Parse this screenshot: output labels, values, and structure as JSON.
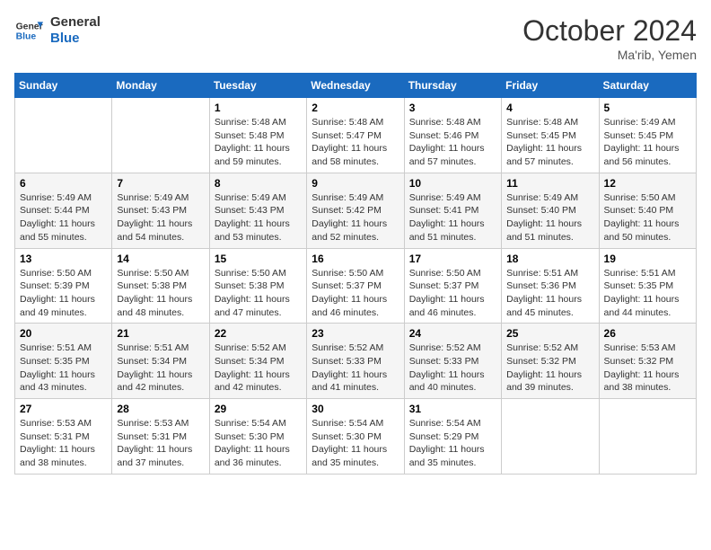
{
  "header": {
    "logo_line1": "General",
    "logo_line2": "Blue",
    "month": "October 2024",
    "location": "Ma'rib, Yemen"
  },
  "weekdays": [
    "Sunday",
    "Monday",
    "Tuesday",
    "Wednesday",
    "Thursday",
    "Friday",
    "Saturday"
  ],
  "weeks": [
    [
      {
        "day": "",
        "info": ""
      },
      {
        "day": "",
        "info": ""
      },
      {
        "day": "1",
        "info": "Sunrise: 5:48 AM\nSunset: 5:48 PM\nDaylight: 11 hours and 59 minutes."
      },
      {
        "day": "2",
        "info": "Sunrise: 5:48 AM\nSunset: 5:47 PM\nDaylight: 11 hours and 58 minutes."
      },
      {
        "day": "3",
        "info": "Sunrise: 5:48 AM\nSunset: 5:46 PM\nDaylight: 11 hours and 57 minutes."
      },
      {
        "day": "4",
        "info": "Sunrise: 5:48 AM\nSunset: 5:45 PM\nDaylight: 11 hours and 57 minutes."
      },
      {
        "day": "5",
        "info": "Sunrise: 5:49 AM\nSunset: 5:45 PM\nDaylight: 11 hours and 56 minutes."
      }
    ],
    [
      {
        "day": "6",
        "info": "Sunrise: 5:49 AM\nSunset: 5:44 PM\nDaylight: 11 hours and 55 minutes."
      },
      {
        "day": "7",
        "info": "Sunrise: 5:49 AM\nSunset: 5:43 PM\nDaylight: 11 hours and 54 minutes."
      },
      {
        "day": "8",
        "info": "Sunrise: 5:49 AM\nSunset: 5:43 PM\nDaylight: 11 hours and 53 minutes."
      },
      {
        "day": "9",
        "info": "Sunrise: 5:49 AM\nSunset: 5:42 PM\nDaylight: 11 hours and 52 minutes."
      },
      {
        "day": "10",
        "info": "Sunrise: 5:49 AM\nSunset: 5:41 PM\nDaylight: 11 hours and 51 minutes."
      },
      {
        "day": "11",
        "info": "Sunrise: 5:49 AM\nSunset: 5:40 PM\nDaylight: 11 hours and 51 minutes."
      },
      {
        "day": "12",
        "info": "Sunrise: 5:50 AM\nSunset: 5:40 PM\nDaylight: 11 hours and 50 minutes."
      }
    ],
    [
      {
        "day": "13",
        "info": "Sunrise: 5:50 AM\nSunset: 5:39 PM\nDaylight: 11 hours and 49 minutes."
      },
      {
        "day": "14",
        "info": "Sunrise: 5:50 AM\nSunset: 5:38 PM\nDaylight: 11 hours and 48 minutes."
      },
      {
        "day": "15",
        "info": "Sunrise: 5:50 AM\nSunset: 5:38 PM\nDaylight: 11 hours and 47 minutes."
      },
      {
        "day": "16",
        "info": "Sunrise: 5:50 AM\nSunset: 5:37 PM\nDaylight: 11 hours and 46 minutes."
      },
      {
        "day": "17",
        "info": "Sunrise: 5:50 AM\nSunset: 5:37 PM\nDaylight: 11 hours and 46 minutes."
      },
      {
        "day": "18",
        "info": "Sunrise: 5:51 AM\nSunset: 5:36 PM\nDaylight: 11 hours and 45 minutes."
      },
      {
        "day": "19",
        "info": "Sunrise: 5:51 AM\nSunset: 5:35 PM\nDaylight: 11 hours and 44 minutes."
      }
    ],
    [
      {
        "day": "20",
        "info": "Sunrise: 5:51 AM\nSunset: 5:35 PM\nDaylight: 11 hours and 43 minutes."
      },
      {
        "day": "21",
        "info": "Sunrise: 5:51 AM\nSunset: 5:34 PM\nDaylight: 11 hours and 42 minutes."
      },
      {
        "day": "22",
        "info": "Sunrise: 5:52 AM\nSunset: 5:34 PM\nDaylight: 11 hours and 42 minutes."
      },
      {
        "day": "23",
        "info": "Sunrise: 5:52 AM\nSunset: 5:33 PM\nDaylight: 11 hours and 41 minutes."
      },
      {
        "day": "24",
        "info": "Sunrise: 5:52 AM\nSunset: 5:33 PM\nDaylight: 11 hours and 40 minutes."
      },
      {
        "day": "25",
        "info": "Sunrise: 5:52 AM\nSunset: 5:32 PM\nDaylight: 11 hours and 39 minutes."
      },
      {
        "day": "26",
        "info": "Sunrise: 5:53 AM\nSunset: 5:32 PM\nDaylight: 11 hours and 38 minutes."
      }
    ],
    [
      {
        "day": "27",
        "info": "Sunrise: 5:53 AM\nSunset: 5:31 PM\nDaylight: 11 hours and 38 minutes."
      },
      {
        "day": "28",
        "info": "Sunrise: 5:53 AM\nSunset: 5:31 PM\nDaylight: 11 hours and 37 minutes."
      },
      {
        "day": "29",
        "info": "Sunrise: 5:54 AM\nSunset: 5:30 PM\nDaylight: 11 hours and 36 minutes."
      },
      {
        "day": "30",
        "info": "Sunrise: 5:54 AM\nSunset: 5:30 PM\nDaylight: 11 hours and 35 minutes."
      },
      {
        "day": "31",
        "info": "Sunrise: 5:54 AM\nSunset: 5:29 PM\nDaylight: 11 hours and 35 minutes."
      },
      {
        "day": "",
        "info": ""
      },
      {
        "day": "",
        "info": ""
      }
    ]
  ]
}
